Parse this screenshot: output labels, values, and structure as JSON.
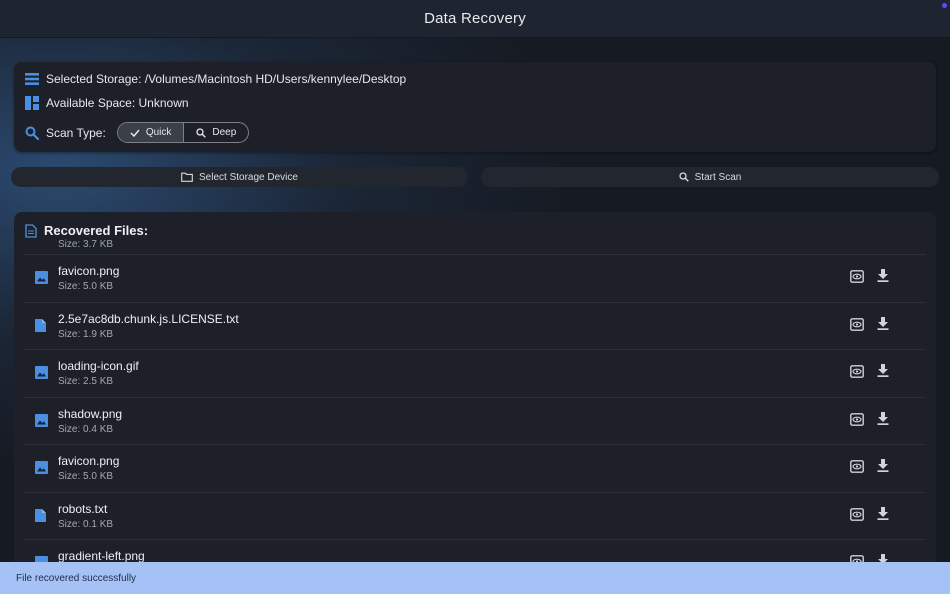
{
  "window": {
    "title": "Data Recovery"
  },
  "info": {
    "storage_label": "Selected Storage: /Volumes/Macintosh HD/Users/kennylee/Desktop",
    "space_label": "Available Space: Unknown",
    "scan_type_label": "Scan Type:",
    "scan_options": [
      {
        "label": "Quick",
        "selected": true
      },
      {
        "label": "Deep",
        "selected": false
      }
    ]
  },
  "actions": {
    "select_storage_label": "Select Storage Device",
    "start_scan_label": "Start Scan"
  },
  "files": {
    "header": "Recovered Files:",
    "partial_top_size": "Size: 3.7 KB",
    "items": [
      {
        "name": "favicon.png",
        "size": "Size: 5.0 KB",
        "kind": "image-icon"
      },
      {
        "name": "2.5e7ac8db.chunk.js.LICENSE.txt",
        "size": "Size: 1.9 KB",
        "kind": "document-icon"
      },
      {
        "name": "loading-icon.gif",
        "size": "Size: 2.5 KB",
        "kind": "image-icon"
      },
      {
        "name": "shadow.png",
        "size": "Size: 0.4 KB",
        "kind": "image-icon"
      },
      {
        "name": "favicon.png",
        "size": "Size: 5.0 KB",
        "kind": "image-icon"
      },
      {
        "name": "robots.txt",
        "size": "Size: 0.1 KB",
        "kind": "document-icon"
      },
      {
        "name": "gradient-left.png",
        "size": "",
        "kind": "image-icon"
      }
    ]
  },
  "status": {
    "message": "File recovered successfully"
  },
  "colors": {
    "accent": "#4a90e2",
    "status_bg": "#a6c1f5",
    "card_bg": "#1d2028"
  }
}
